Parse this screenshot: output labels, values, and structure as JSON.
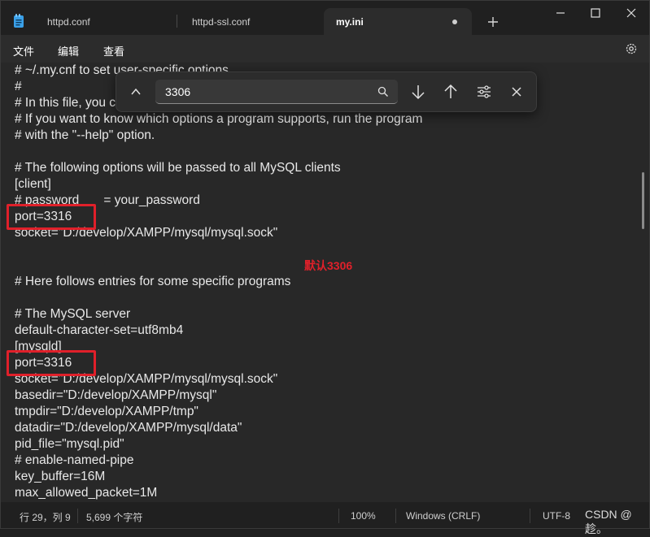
{
  "tabs": [
    {
      "label": "httpd.conf"
    },
    {
      "label": "httpd-ssl.conf"
    },
    {
      "label": "my.ini",
      "active": true,
      "unsaved": true
    }
  ],
  "menu": {
    "file": "文件",
    "edit": "编辑",
    "view": "查看"
  },
  "find": {
    "value": "3306"
  },
  "editor_lines": [
    "# ~/.my.cnf to set user-specific options.",
    "#",
    "# In this file, you can use all long options that a program supports.",
    "# If you want to know which options a program supports, run the program",
    "# with the \"--help\" option.",
    "",
    "# The following options will be passed to all MySQL clients",
    "[client]",
    "# password       = your_password",
    "port=3316",
    "socket=\"D:/develop/XAMPP/mysql/mysql.sock\"",
    "",
    "",
    "# Here follows entries for some specific programs",
    "",
    "# The MySQL server",
    "default-character-set=utf8mb4",
    "[mysqld]",
    "port=3316",
    "socket=\"D:/develop/XAMPP/mysql/mysql.sock\"",
    "basedir=\"D:/develop/XAMPP/mysql\"",
    "tmpdir=\"D:/develop/XAMPP/tmp\"",
    "datadir=\"D:/develop/XAMPP/mysql/data\"",
    "pid_file=\"mysql.pid\"",
    "# enable-named-pipe",
    "key_buffer=16M",
    "max_allowed_packet=1M"
  ],
  "annotation": {
    "text": "默认3306",
    "color": "#e0202a"
  },
  "status": {
    "position": "行 29，列 9",
    "chars": "5,699 个字符",
    "zoom": "100%",
    "line_ending": "Windows (CRLF)",
    "encoding": "UTF-8"
  },
  "watermark": "CSDN @趁。",
  "colors": {
    "background": "#282828",
    "highlight": "#e0202a"
  }
}
